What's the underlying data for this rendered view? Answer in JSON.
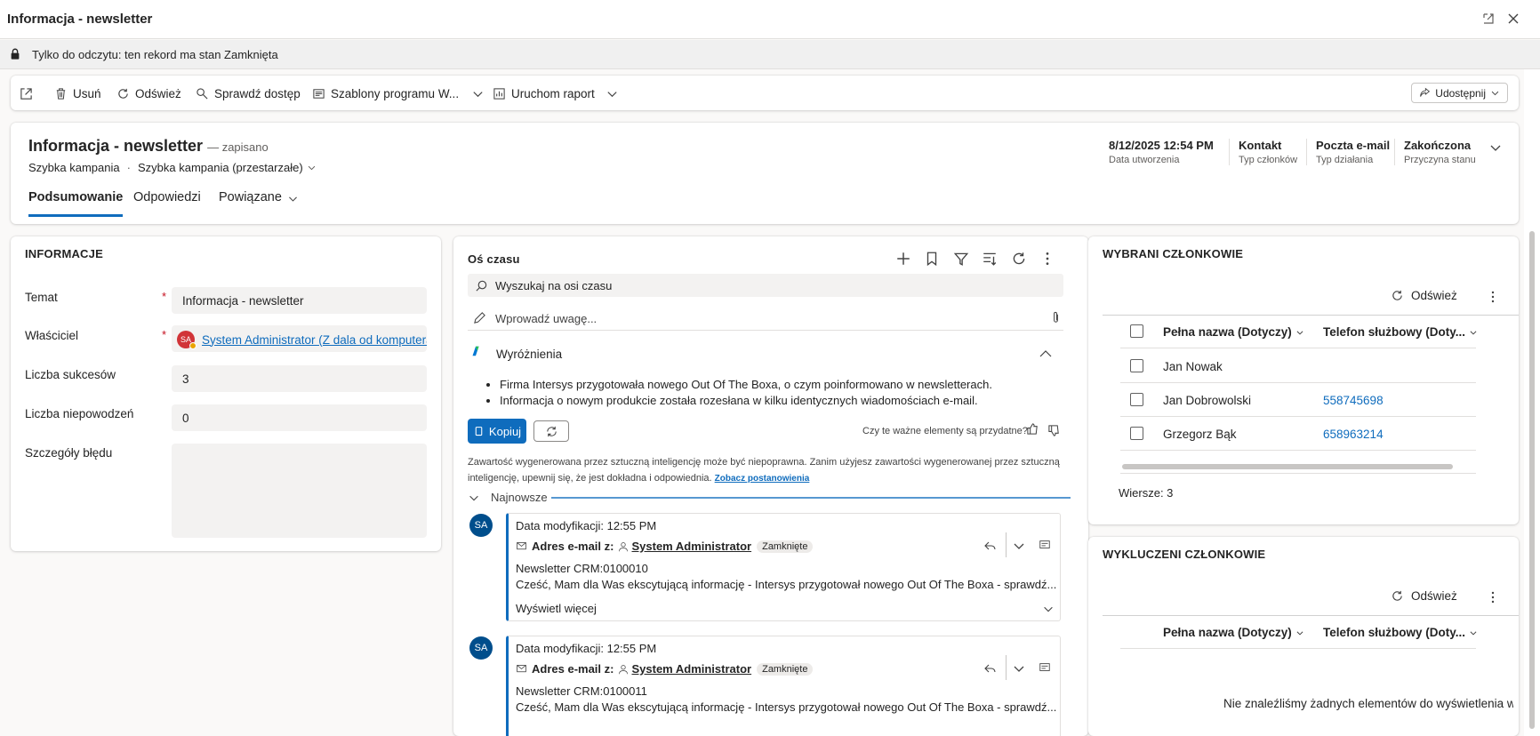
{
  "window": {
    "title": "Informacja - newsletter"
  },
  "readonly_banner": {
    "text": "Tylko do odczytu: ten rekord ma stan Zamknięta"
  },
  "commands": {
    "delete": "Usuń",
    "refresh": "Odśwież",
    "check_access": "Sprawdź dostęp",
    "templates": "Szablony programu W...",
    "run_report": "Uruchom raport",
    "share": "Udostępnij"
  },
  "header": {
    "title": "Informacja - newsletter",
    "saved": "— zapisano",
    "entity": "Szybka kampania",
    "separator": "·",
    "form": "Szybka kampania (przestarzałe)",
    "fields": [
      {
        "value": "8/12/2025 12:54 PM",
        "label": "Data utworzenia"
      },
      {
        "value": "Kontakt",
        "label": "Typ członków"
      },
      {
        "value": "Poczta e-mail",
        "label": "Typ działania"
      },
      {
        "value": "Zakończona",
        "label": "Przyczyna stanu"
      }
    ],
    "tabs": [
      "Podsumowanie",
      "Odpowiedzi",
      "Powiązane"
    ]
  },
  "info": {
    "section_title": "INFORMACJE",
    "fields": [
      {
        "label": "Temat",
        "value": "Informacja - newsletter",
        "required": "*"
      },
      {
        "label": "Właściciel",
        "value": "System Administrator (Z dala od komputera)",
        "initials": "SA",
        "required": "*"
      },
      {
        "label": "Liczba sukcesów",
        "value": "3"
      },
      {
        "label": "Liczba niepowodzeń",
        "value": "0"
      },
      {
        "label": "Szczegóły błędu",
        "value": ""
      }
    ]
  },
  "timeline": {
    "title": "Oś czasu",
    "search_placeholder": "Wyszukaj na osi czasu",
    "note_placeholder": "Wprowadź uwagę...",
    "highlights_title": "Wyróżnienia",
    "highlights": [
      "Firma Intersys przygotowała nowego Out Of The Boxa, o czym poinformowano w newsletterach.",
      "Informacja o nowym produkcie została rozesłana w kilku identycznych wiadomościach e-mail."
    ],
    "copy_label": "Kopiuj",
    "feedback_question": "Czy te ważne elementy są przydatne?",
    "disclaimer": "Zawartość wygenerowana przez sztuczną inteligencję może być niepoprawna. Zanim użyjesz zawartości wygenerowanej przez sztuczną inteligencję, upewnij się, że jest dokładna i odpowiednia.",
    "terms_link": "Zobacz postanowienia",
    "newest_label": "Najnowsze",
    "posts": [
      {
        "initials": "SA",
        "modified": "Data modyfikacji: 12:55 PM",
        "type": "Adres e-mail z:",
        "author": "System Administrator",
        "status": "Zamknięte",
        "subject": "Newsletter CRM:0100010",
        "preview": "Cześć,   Mam dla Was ekscytującą informację - Intersys przygotował nowego Out Of The Boxa - sprawdź...",
        "more": "Wyświetl więcej"
      },
      {
        "initials": "SA",
        "modified": "Data modyfikacji: 12:55 PM",
        "type": "Adres e-mail z:",
        "author": "System Administrator",
        "status": "Zamknięte",
        "subject": "Newsletter CRM:0100011",
        "preview": "Cześć,   Mam dla Was ekscytującą informację - Intersys przygotował nowego Out Of The Boxa - sprawdź..."
      }
    ]
  },
  "selected_members": {
    "title": "WYBRANI CZŁONKOWIE",
    "refresh": "Odśwież",
    "col_name": "Pełna nazwa (Dotyczy)",
    "col_phone": "Telefon służbowy (Doty...",
    "rows": [
      {
        "name": "Jan Nowak",
        "phone": ""
      },
      {
        "name": "Jan Dobrowolski",
        "phone": "558745698"
      },
      {
        "name": "Grzegorz Bąk",
        "phone": "658963214"
      }
    ],
    "row_count": "Wiersze: 3"
  },
  "excluded_members": {
    "title": "WYKLUCZENI CZŁONKOWIE",
    "refresh": "Odśwież",
    "col_name": "Pełna nazwa (Dotyczy)",
    "col_phone": "Telefon służbowy (Doty...",
    "empty": "Nie znaleźliśmy żadnych elementów do wyświetlenia w ty"
  },
  "colors": {
    "accent": "#0f6cbd",
    "required": "#c50f1f",
    "avatar_owner": "#d13438"
  }
}
